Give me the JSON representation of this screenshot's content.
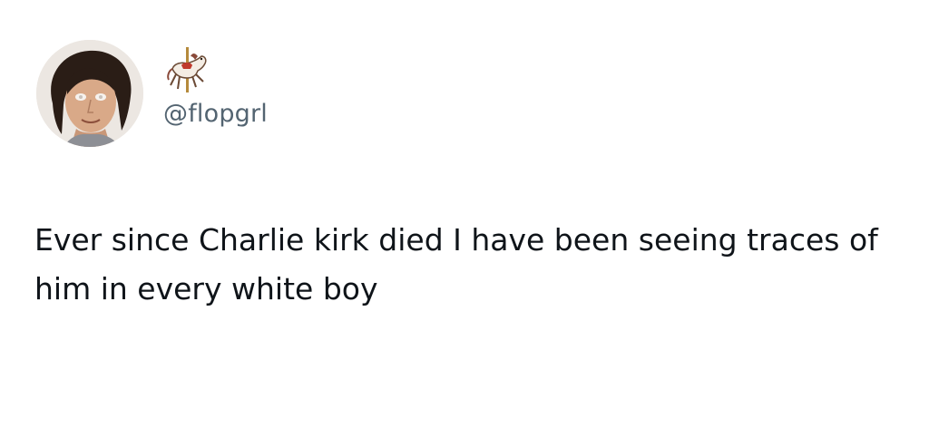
{
  "tweet": {
    "author": {
      "avatar_icon": "profile-photo",
      "display_name_icon": "carousel-horse-emoji",
      "handle": "@flopgrl"
    },
    "text": "Ever since Charlie kirk died I have been seeing traces of him in every white boy"
  },
  "colors": {
    "text": "#0f1419",
    "handle": "#536471",
    "background": "#ffffff"
  }
}
